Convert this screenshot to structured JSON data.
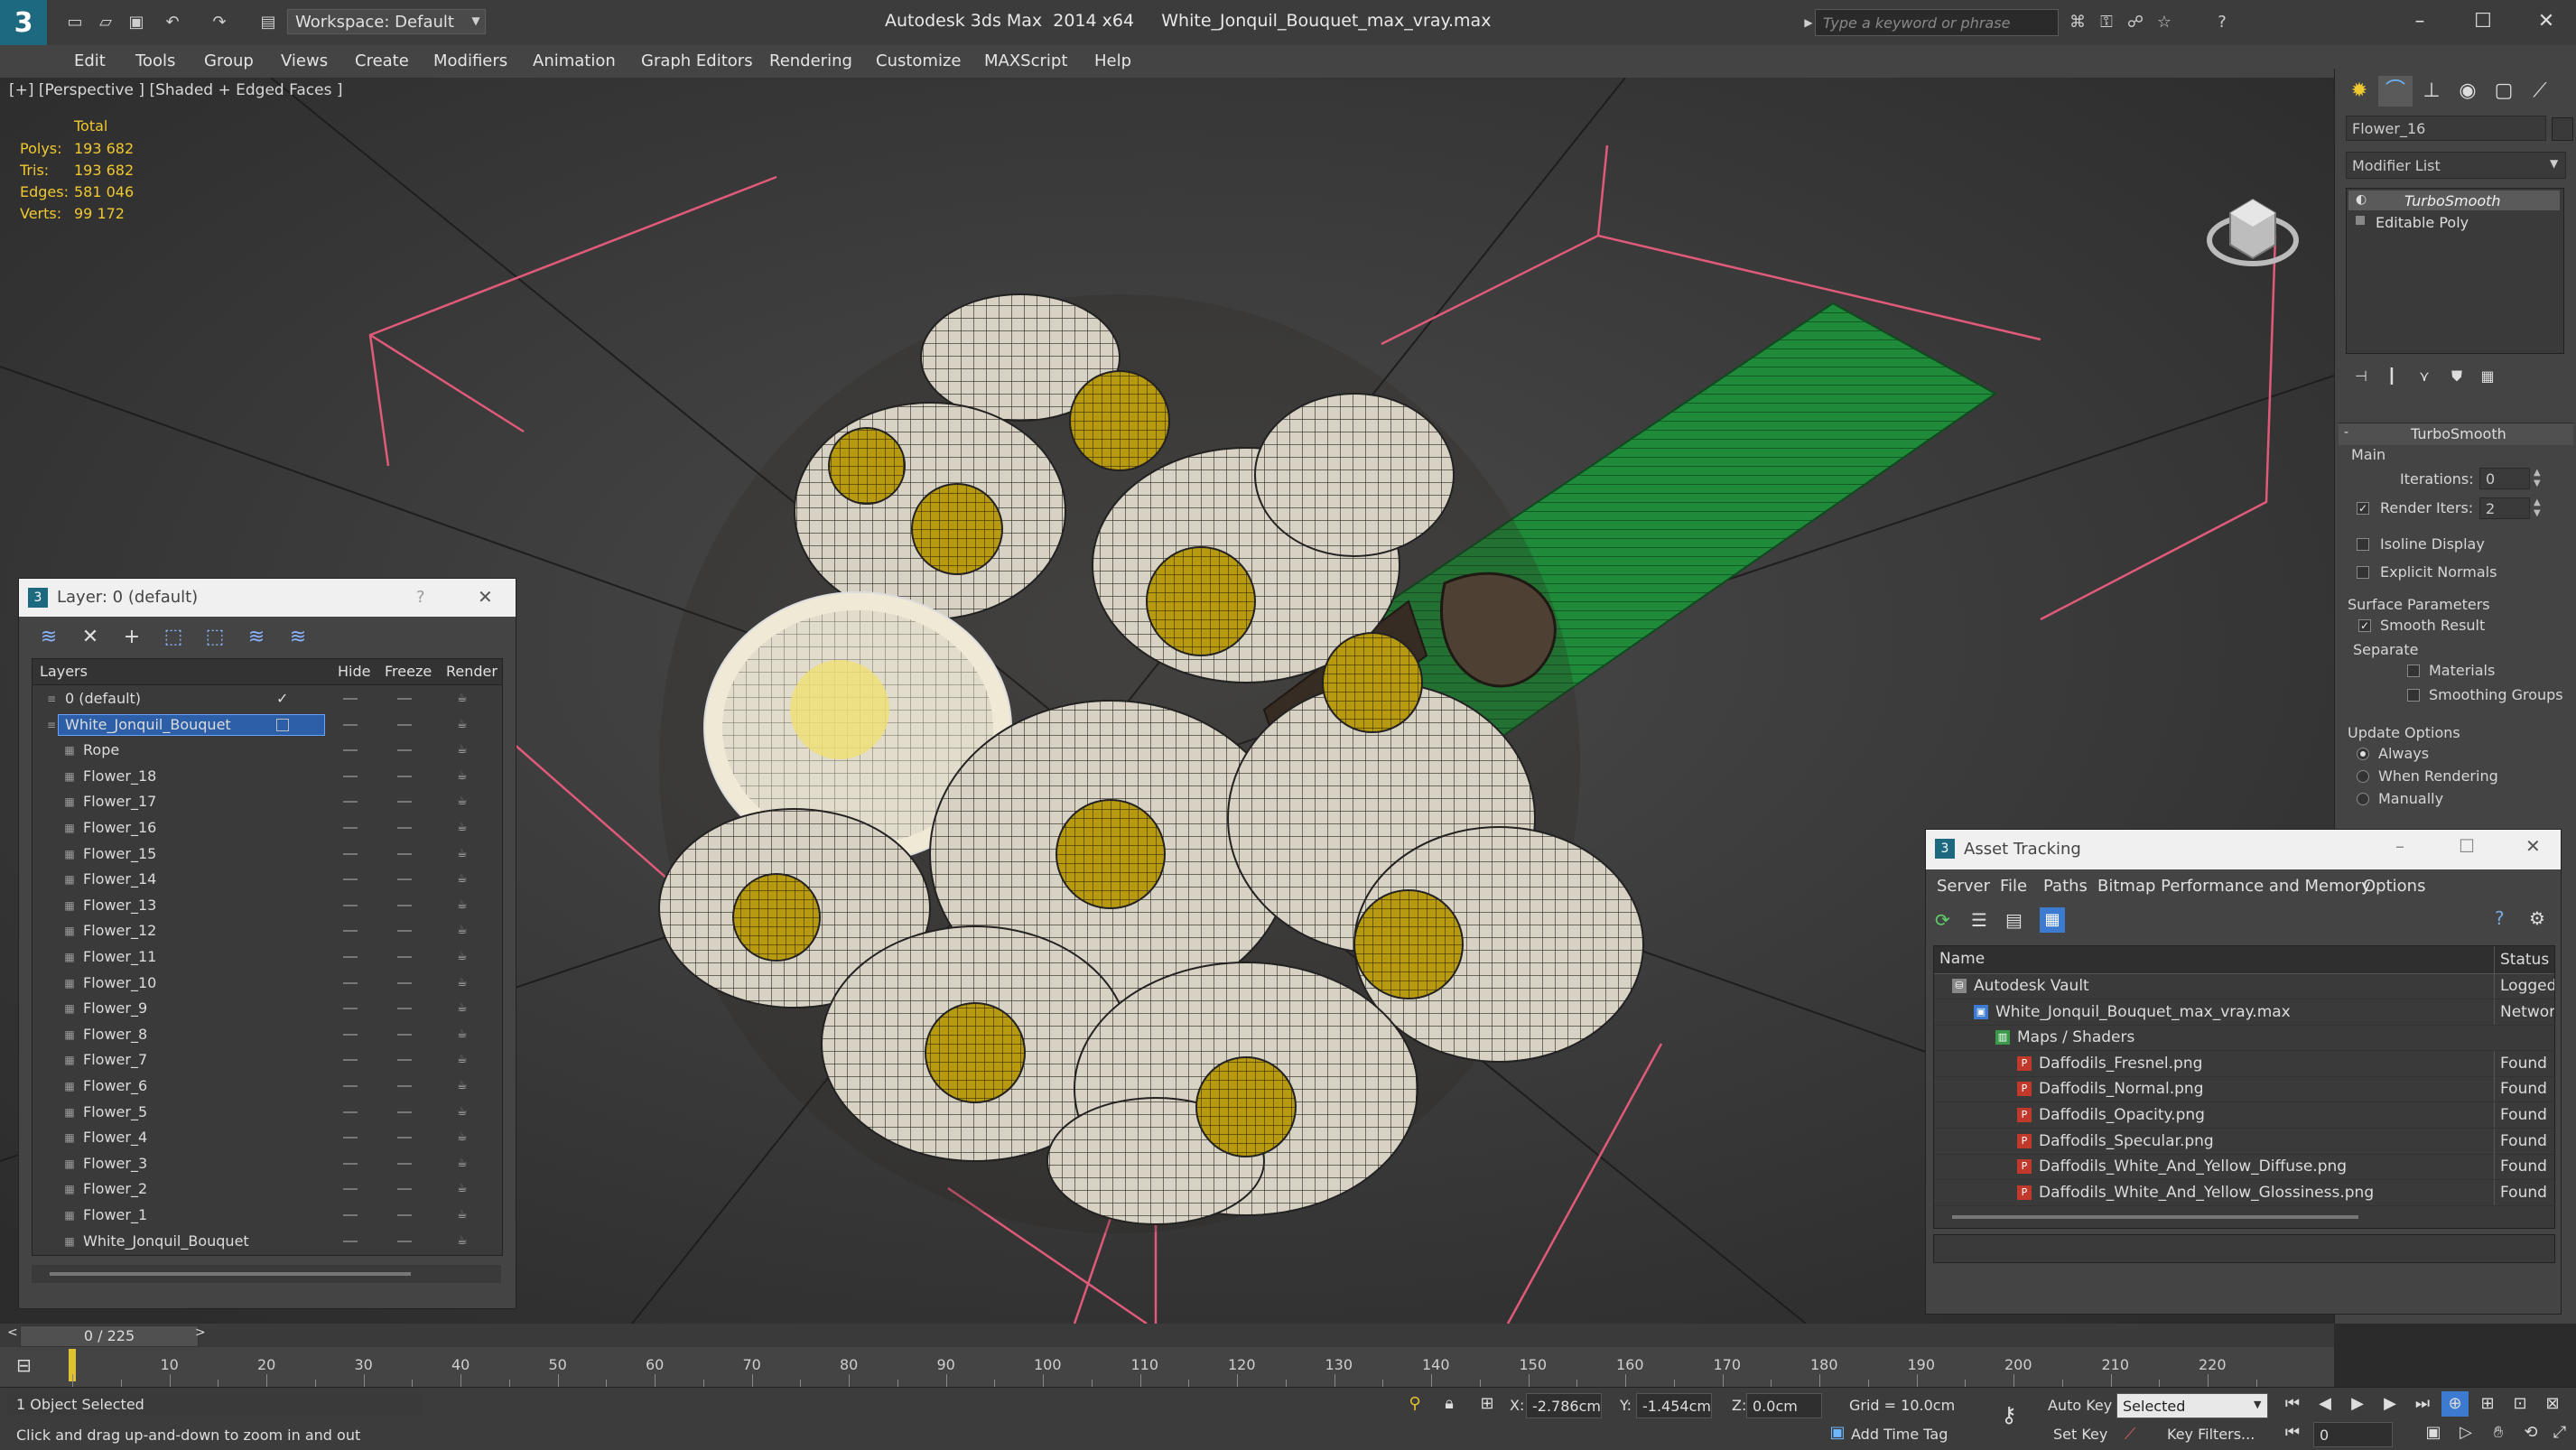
{
  "app": {
    "title": "Autodesk 3ds Max  2014 x64     White_Jonquil_Bouquet_max_vray.max",
    "logo": "3ds-max-logo",
    "workspace": "Workspace: Default",
    "search_placeholder": "Type a keyword or phrase"
  },
  "menu": [
    "Edit",
    "Tools",
    "Group",
    "Views",
    "Create",
    "Modifiers",
    "Animation",
    "Graph Editors",
    "Rendering",
    "Customize",
    "MAXScript",
    "Help"
  ],
  "viewport": {
    "label": "[+] [Perspective ] [Shaded + Edged Faces ]",
    "stats": {
      "total_label": "Total",
      "rows": [
        {
          "k": "Polys:",
          "v": "193 682"
        },
        {
          "k": "Tris:",
          "v": "193 682"
        },
        {
          "k": "Edges:",
          "v": "581 046"
        },
        {
          "k": "Verts:",
          "v": "99 172"
        }
      ]
    },
    "colors": {
      "grid": "#e05a7a",
      "stat_value": "#f0c830",
      "highlight": "#2d5fa8"
    }
  },
  "command_panel": {
    "object_name": "Flower_16",
    "modifier_list": "Modifier List",
    "stack": [
      "TurboSmooth",
      "Editable Poly"
    ],
    "rollout_title": "TurboSmooth",
    "main": "Main",
    "iterations_label": "Iterations:",
    "iterations": "0",
    "render_iters_label": "Render Iters:",
    "render_iters": "2",
    "isoline": "Isoline Display",
    "explicit_normals": "Explicit Normals",
    "surface_params": "Surface Parameters",
    "smooth_result": "Smooth Result",
    "separate": "Separate",
    "materials": "Materials",
    "smoothing_groups": "Smoothing Groups",
    "update_options": "Update Options",
    "always": "Always",
    "when_rendering": "When Rendering",
    "manually": "Manually"
  },
  "layer_dialog": {
    "title": "Layer: 0 (default)",
    "help": "?",
    "close": "✕",
    "columns": [
      "Layers",
      "Hide",
      "Freeze",
      "Render"
    ],
    "layers": [
      {
        "name": "0 (default)",
        "level": 0
      },
      {
        "name": "White_Jonquil_Bouquet",
        "level": 0,
        "selected": true
      },
      {
        "name": "Rope",
        "level": 1
      },
      {
        "name": "Flower_18",
        "level": 1
      },
      {
        "name": "Flower_17",
        "level": 1
      },
      {
        "name": "Flower_16",
        "level": 1
      },
      {
        "name": "Flower_15",
        "level": 1
      },
      {
        "name": "Flower_14",
        "level": 1
      },
      {
        "name": "Flower_13",
        "level": 1
      },
      {
        "name": "Flower_12",
        "level": 1
      },
      {
        "name": "Flower_11",
        "level": 1
      },
      {
        "name": "Flower_10",
        "level": 1
      },
      {
        "name": "Flower_9",
        "level": 1
      },
      {
        "name": "Flower_8",
        "level": 1
      },
      {
        "name": "Flower_7",
        "level": 1
      },
      {
        "name": "Flower_6",
        "level": 1
      },
      {
        "name": "Flower_5",
        "level": 1
      },
      {
        "name": "Flower_4",
        "level": 1
      },
      {
        "name": "Flower_3",
        "level": 1
      },
      {
        "name": "Flower_2",
        "level": 1
      },
      {
        "name": "Flower_1",
        "level": 1
      },
      {
        "name": "White_Jonquil_Bouquet",
        "level": 1
      }
    ]
  },
  "asset_dialog": {
    "title": "Asset Tracking",
    "menu": [
      "Server",
      "File",
      "Paths",
      "Bitmap Performance and Memory",
      "Options"
    ],
    "columns": [
      "Name",
      "Status"
    ],
    "rows": [
      {
        "name": "Autodesk Vault",
        "status": "Logged",
        "level": 0,
        "icon": "vault-icon"
      },
      {
        "name": "White_Jonquil_Bouquet_max_vray.max",
        "status": "Network",
        "level": 1,
        "icon": "max-file-icon"
      },
      {
        "name": "Maps / Shaders",
        "status": "",
        "level": 2,
        "icon": "maps-icon"
      },
      {
        "name": "Daffodils_Fresnel.png",
        "status": "Found",
        "level": 3,
        "icon": "png-icon"
      },
      {
        "name": "Daffodils_Normal.png",
        "status": "Found",
        "level": 3,
        "icon": "png-icon"
      },
      {
        "name": "Daffodils_Opacity.png",
        "status": "Found",
        "level": 3,
        "icon": "png-icon"
      },
      {
        "name": "Daffodils_Specular.png",
        "status": "Found",
        "level": 3,
        "icon": "png-icon"
      },
      {
        "name": "Daffodils_White_And_Yellow_Diffuse.png",
        "status": "Found",
        "level": 3,
        "icon": "png-icon"
      },
      {
        "name": "Daffodils_White_And_Yellow_Glossiness.png",
        "status": "Found",
        "level": 3,
        "icon": "png-icon"
      }
    ]
  },
  "timeline": {
    "frame": "0 / 225",
    "ticks": [
      "10",
      "20",
      "30",
      "40",
      "50",
      "60",
      "70",
      "80",
      "90",
      "100",
      "110",
      "120",
      "130",
      "140",
      "150",
      "160",
      "170",
      "180",
      "190",
      "200",
      "210",
      "220"
    ]
  },
  "status": {
    "selected": "1 Object Selected",
    "hint": "Click and drag up-and-down to zoom in and out",
    "x_label": "X:",
    "x": "-2.786cm",
    "y_label": "Y:",
    "y": "-1.454cm",
    "z_label": "Z:",
    "z": "0.0cm",
    "grid": "Grid = 10.0cm",
    "auto_key": "Auto Key",
    "set_key": "Set Key",
    "selected_dropdown": "Selected",
    "key_filters": "Key Filters...",
    "add_time_tag": "Add Time Tag",
    "frame_field": "0"
  }
}
